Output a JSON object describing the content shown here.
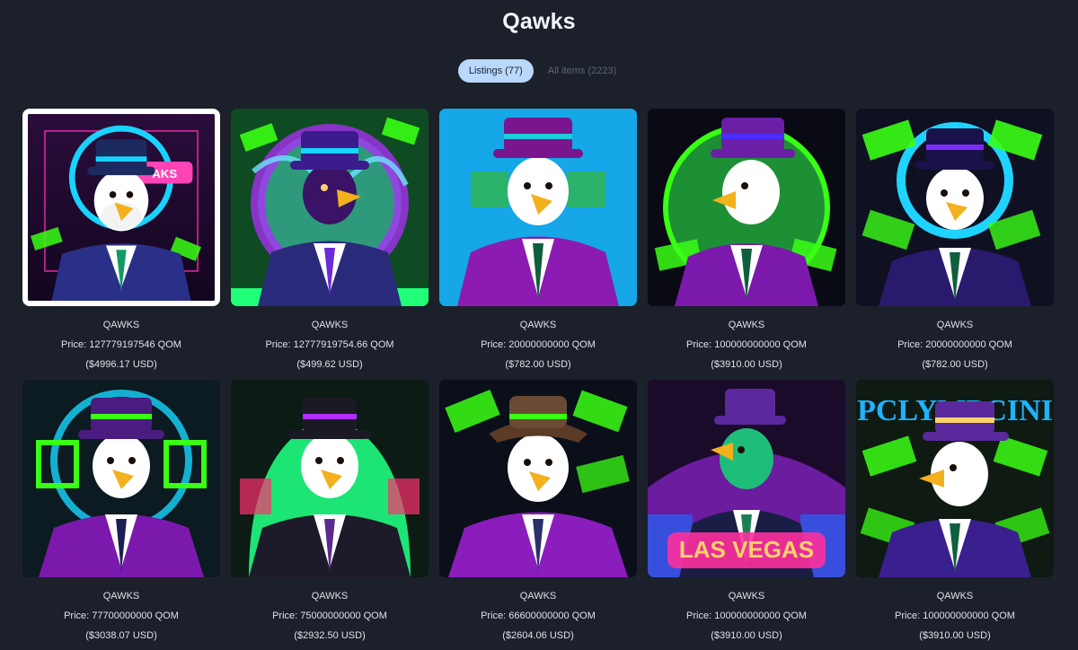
{
  "title": "Qawks",
  "tabs": [
    {
      "label": "Listings (77)",
      "active": true
    },
    {
      "label": "All items (2223)",
      "active": false
    }
  ],
  "items": [
    {
      "name": "QAWKS",
      "price": "Price: 127779197546 QOM",
      "usd": "($4996.17 USD)",
      "selected": true
    },
    {
      "name": "QAWKS",
      "price": "Price: 12777919754.66 QOM",
      "usd": "($499.62 USD)",
      "selected": false
    },
    {
      "name": "QAWKS",
      "price": "Price: 20000000000 QOM",
      "usd": "($782.00 USD)",
      "selected": false
    },
    {
      "name": "QAWKS",
      "price": "Price: 100000000000 QOM",
      "usd": "($3910.00 USD)",
      "selected": false
    },
    {
      "name": "QAWKS",
      "price": "Price: 20000000000 QOM",
      "usd": "($782.00 USD)",
      "selected": false
    },
    {
      "name": "QAWKS",
      "price": "Price: 77700000000 QOM",
      "usd": "($3038.07 USD)",
      "selected": false
    },
    {
      "name": "QAWKS",
      "price": "Price: 75000000000 QOM",
      "usd": "($2932.50 USD)",
      "selected": false
    },
    {
      "name": "QAWKS",
      "price": "Price: 66600000000 QOM",
      "usd": "($2604.06 USD)",
      "selected": false
    },
    {
      "name": "QAWKS",
      "price": "Price: 100000000000 QOM",
      "usd": "($3910.00 USD)",
      "selected": false
    },
    {
      "name": "QAWKS",
      "price": "Price: 100000000000 QOM",
      "usd": "($3910.00 USD)",
      "selected": false
    }
  ],
  "art_text": {
    "card1_sign": "AKS",
    "card9_sign": "LAS VEGAS",
    "card10_sign": "PCLYMPCINI"
  },
  "colors": {
    "page_bg": "#1b202a",
    "tab_active_bg": "#b9d8fb",
    "tab_inactive_text": "#5c6677",
    "neon_purple": "#8a2be2",
    "neon_green": "#39ff14",
    "sky_blue": "#15a7e8"
  }
}
